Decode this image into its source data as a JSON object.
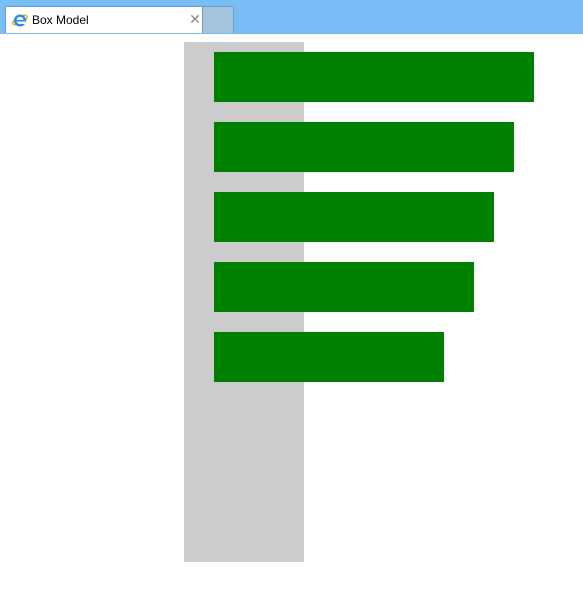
{
  "browser": {
    "tab": {
      "title": "Box Model",
      "close_glyph": "✕",
      "icon": "internet-explorer-icon"
    }
  },
  "page": {
    "colors": {
      "container": "#cccccc",
      "bar": "#008000",
      "tabbar": "#78bdf5"
    },
    "bars_count": 5
  }
}
